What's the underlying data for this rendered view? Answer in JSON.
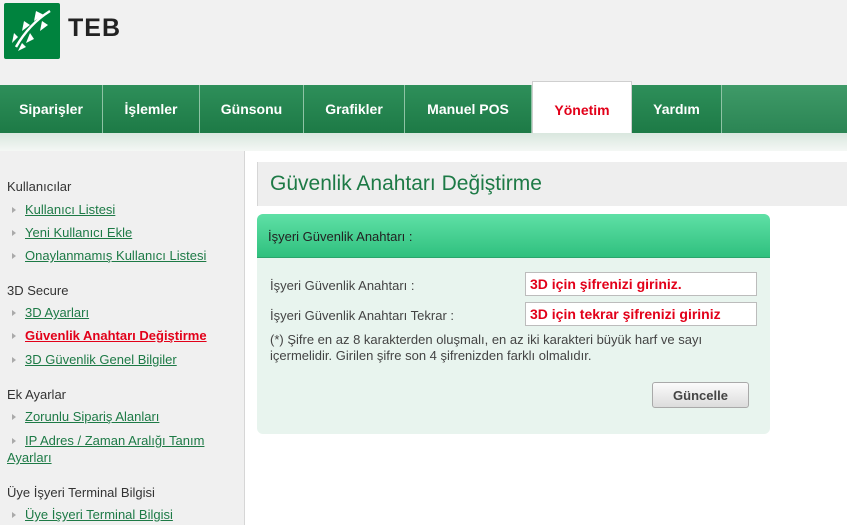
{
  "brand": {
    "name": "TEB",
    "logo_color": "#00833e"
  },
  "nav": {
    "tabs": [
      {
        "label": "Siparişler"
      },
      {
        "label": "İşlemler"
      },
      {
        "label": "Günsonu"
      },
      {
        "label": "Grafikler"
      },
      {
        "label": "Manuel POS"
      },
      {
        "label": "Yönetim",
        "active": true
      },
      {
        "label": "Yardım"
      }
    ]
  },
  "sidebar": {
    "sections": [
      {
        "title": "Kullanıcılar",
        "items": [
          "Kullanıcı Listesi",
          "Yeni Kullanıcı Ekle",
          "Onaylanmamış Kullanıcı Listesi"
        ]
      },
      {
        "title": "3D Secure",
        "items": [
          "3D Ayarları",
          "Güvenlik Anahtarı Değiştirme",
          "3D Güvenlik Genel Bilgiler"
        ]
      },
      {
        "title": "Ek Ayarlar",
        "items": [
          "Zorunlu Sipariş Alanları",
          "IP Adres / Zaman Aralığı Tanım",
          "Ayarları"
        ]
      },
      {
        "title": "Üye İşyeri Terminal Bilgisi",
        "items": [
          "Üye İşyeri Terminal Bilgisi"
        ]
      }
    ],
    "active_item": "Güvenlik Anahtarı Değiştirme"
  },
  "main": {
    "title": "Güvenlik Anahtarı Değiştirme",
    "panel_header": "İşyeri Güvenlik Anahtarı :",
    "key_label": "İşyeri Güvenlik Anahtarı :",
    "key_placeholder": "3D için şifrenizi giriniz.",
    "key_repeat_label": "İşyeri Güvenlik Anahtarı Tekrar :",
    "key_repeat_placeholder": "3D için tekrar şifrenizi giriniz",
    "note": "(*) Şifre en az 8 karakterden oluşmalı, en az iki karakteri büyük harf ve sayı içermelidir. Girilen şifre son 4 şifrenizden farklı olmalıdır.",
    "update_button": "Güncelle"
  },
  "colors": {
    "accent": "#1d7a46",
    "active": "#e20019",
    "panel_header": "#3fcf8b"
  }
}
